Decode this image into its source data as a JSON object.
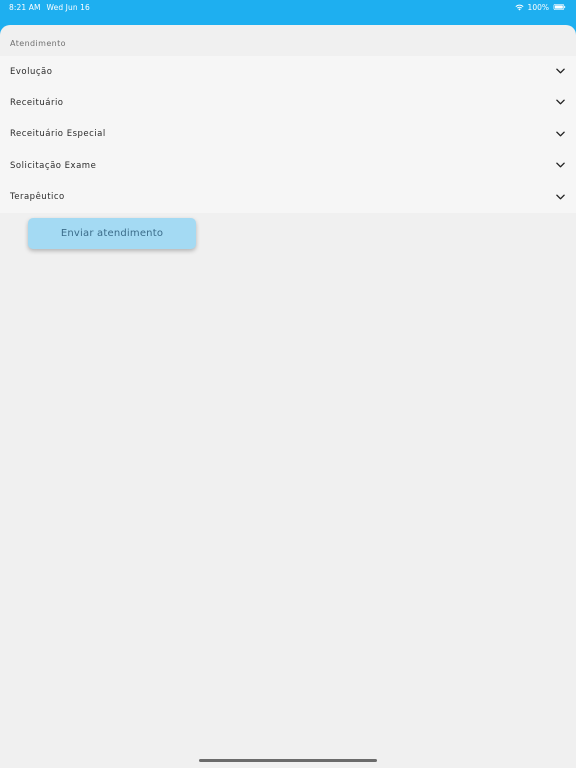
{
  "status_bar": {
    "time": "8:21 AM",
    "date": "Wed Jun 16",
    "battery": "100%",
    "wifi_icon": "wifi-icon",
    "battery_icon": "battery-icon",
    "color": "#1eaff0"
  },
  "section": {
    "header": "Atendimento",
    "items": [
      {
        "label": "Evolução",
        "icon": "chevron-down-icon"
      },
      {
        "label": "Receituário",
        "icon": "chevron-down-icon"
      },
      {
        "label": "Receituário Especial",
        "icon": "chevron-down-icon"
      },
      {
        "label": "Solicitação Exame",
        "icon": "chevron-down-icon"
      },
      {
        "label": "Terapêutico",
        "icon": "chevron-down-icon"
      }
    ]
  },
  "actions": {
    "send_label": "Enviar atendimento",
    "send_color": "#a4daf3"
  }
}
